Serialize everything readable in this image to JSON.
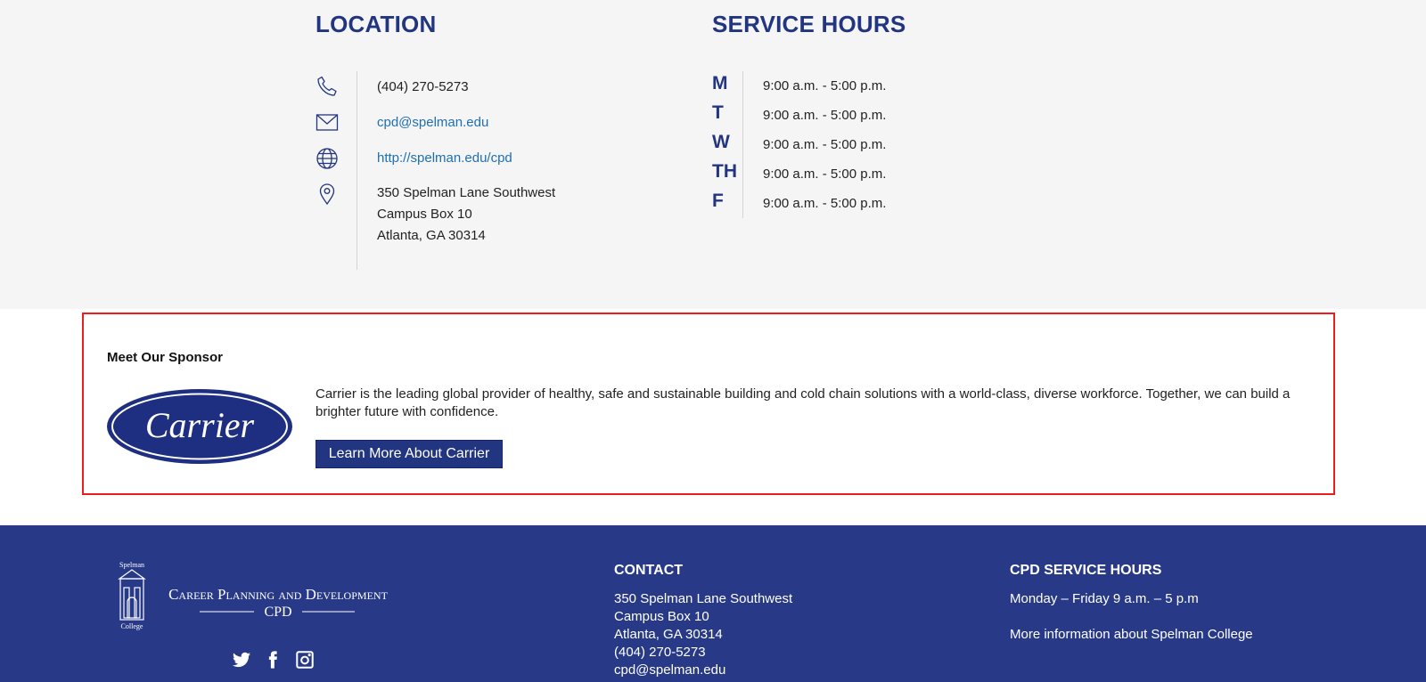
{
  "location": {
    "title": "LOCATION",
    "phone": "(404) 270-5273",
    "email": "cpd@spelman.edu",
    "website": "http://spelman.edu/cpd",
    "address": [
      "350 Spelman Lane Southwest",
      "Campus Box 10",
      "Atlanta, GA 30314"
    ],
    "icons": [
      "phone-icon",
      "envelope-icon",
      "globe-icon",
      "map-pin-icon"
    ]
  },
  "service_hours": {
    "title": "SERVICE HOURS",
    "days": [
      {
        "day": "M",
        "time": "9:00 a.m. - 5:00 p.m."
      },
      {
        "day": "T",
        "time": "9:00 a.m. - 5:00 p.m."
      },
      {
        "day": "W",
        "time": "9:00 a.m. - 5:00 p.m."
      },
      {
        "day": "TH",
        "time": "9:00 a.m. - 5:00 p.m."
      },
      {
        "day": "F",
        "time": "9:00 a.m. - 5:00 p.m."
      }
    ]
  },
  "sponsor": {
    "heading": "Meet Our Sponsor",
    "logo_text": "Carrier",
    "description": "Carrier is the leading global provider of healthy, safe and sustainable building and cold chain solutions with a world-class, diverse workforce. Together, we can build a brighter future with confidence.",
    "button_label": "Learn More About Carrier"
  },
  "footer": {
    "logo": {
      "college_top": "Spelman",
      "college_bottom": "College",
      "title": "Career Planning and Development",
      "abbr": "CPD"
    },
    "social_icons": [
      "twitter-icon",
      "facebook-icon",
      "instagram-icon"
    ],
    "contact": {
      "heading": "CONTACT",
      "lines": [
        "350 Spelman Lane Southwest",
        "Campus Box 10",
        "Atlanta, GA 30314",
        "(404) 270-5273",
        "cpd@spelman.edu"
      ]
    },
    "hours": {
      "heading": "CPD SERVICE HOURS",
      "text": "Monday – Friday 9 a.m. – 5 p.m",
      "more_link": "More information about Spelman College"
    }
  },
  "colors": {
    "navy": "#223581",
    "footer_bg": "#283a87",
    "link_blue": "#1f6fb2",
    "highlight_red": "#ee1c1c",
    "band_bg": "#f5f5f5"
  }
}
